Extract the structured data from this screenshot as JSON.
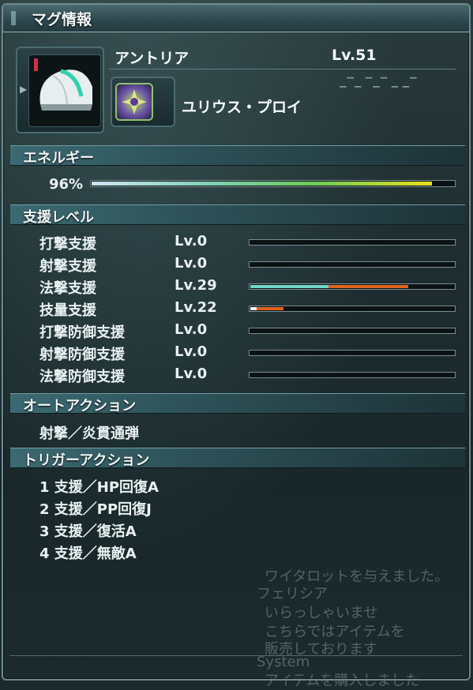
{
  "window": {
    "title": "マグ情報"
  },
  "mag": {
    "name": "アントリア",
    "level": "Lv.51",
    "photon_blast": "ユリウス・プロイ"
  },
  "energy": {
    "section_title": "エネルギー",
    "percent_label": "96%",
    "value": 0.96
  },
  "support": {
    "section_title": "支援レベル",
    "rows": [
      {
        "label": "打撃支援",
        "level": "Lv.0",
        "fill_primary": 0,
        "fill_secondary": 0
      },
      {
        "label": "射撃支援",
        "level": "Lv.0",
        "fill_primary": 0,
        "fill_secondary": 0
      },
      {
        "label": "法撃支援",
        "level": "Lv.29",
        "fill_primary": 0.38,
        "fill_secondary": 0.77
      },
      {
        "label": "技量支援",
        "level": "Lv.22",
        "fill_primary": 0.03,
        "fill_secondary": 0.16
      },
      {
        "label": "打撃防御支援",
        "level": "Lv.0",
        "fill_primary": 0,
        "fill_secondary": 0
      },
      {
        "label": "射撃防御支援",
        "level": "Lv.0",
        "fill_primary": 0,
        "fill_secondary": 0
      },
      {
        "label": "法撃防御支援",
        "level": "Lv.0",
        "fill_primary": 0,
        "fill_secondary": 0
      }
    ]
  },
  "auto_action": {
    "section_title": "オートアクション",
    "items": [
      "射撃／炎貫通弾"
    ]
  },
  "trigger_action": {
    "section_title": "トリガーアクション",
    "items": [
      "1 支援／HP回復A",
      "2 支援／PP回復J",
      "3 支援／復活A",
      "4 支援／無敵A"
    ]
  },
  "background_chat": [
    "ワイタロットを与えました。",
    "フェリシア",
    "いらっしゃいませ",
    "こちらではアイテムを",
    "販売しております",
    "System",
    "アイテムを購入しました"
  ],
  "colors": {
    "accent": "#3c6a72",
    "bar_primary": "#6fd6c8",
    "bar_secondary": "#e0641e"
  },
  "icons": {
    "mag": "mag-helmet-icon",
    "photon_blast": "photon-blast-icon"
  }
}
